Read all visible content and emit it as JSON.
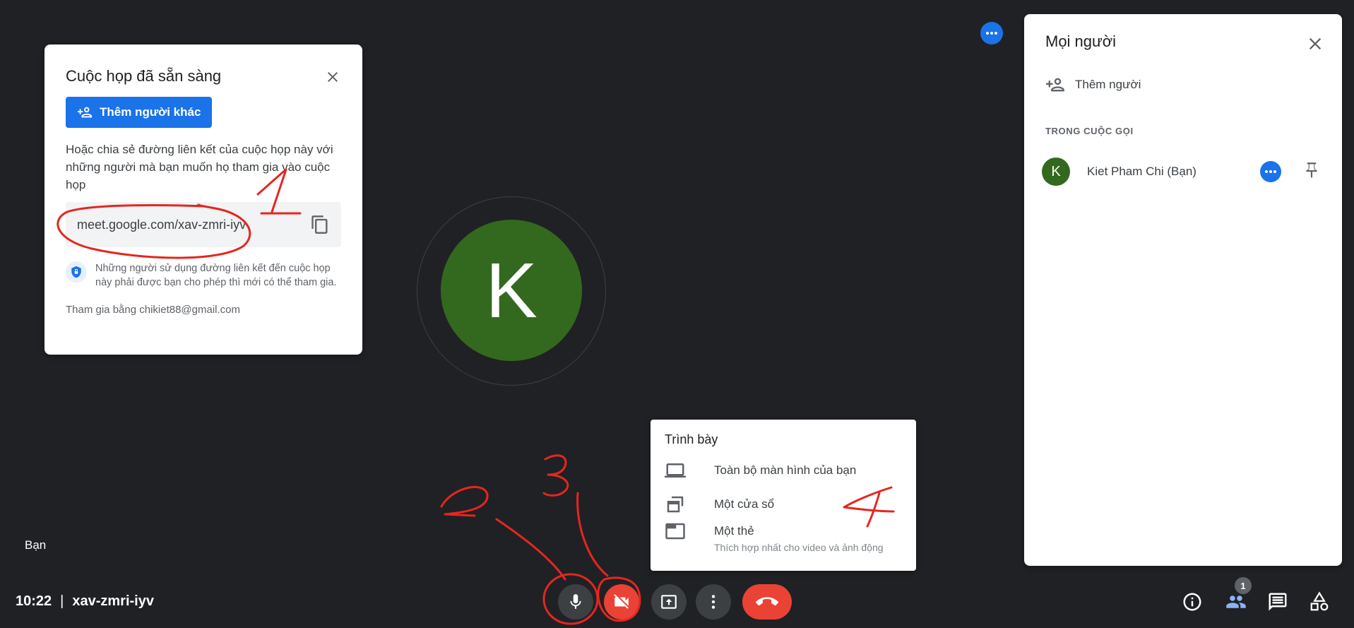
{
  "ready_dialog": {
    "title": "Cuộc họp đã sẵn sàng",
    "add_button": "Thêm người khác",
    "share_text": "Hoặc chia sẻ đường liên kết của cuộc họp này với những người mà bạn muốn họ tham gia vào cuộc họp",
    "link": "meet.google.com/xav-zmri-iyv",
    "info_text": "Những người sử dụng đường liên kết đến cuộc họp này phải được bạn cho phép thì mới có thể tham gia.",
    "joined_as": "Tham gia bằng chikiet88@gmail.com"
  },
  "main": {
    "avatar_letter": "K",
    "you_label": "Bạn"
  },
  "people_panel": {
    "title": "Mọi người",
    "add_person": "Thêm người",
    "section_label": "TRONG CUỘC GỌI",
    "participants": [
      {
        "initial": "K",
        "name": "Kiet Pham Chi (Bạn)"
      }
    ]
  },
  "present_menu": {
    "title": "Trình bày",
    "items": [
      {
        "label": "Toàn bộ màn hình của bạn",
        "icon": "laptop-icon"
      },
      {
        "label": "Một cửa sổ",
        "icon": "window-icon"
      },
      {
        "label": "Một thẻ",
        "sub": "Thích hợp nhất cho video và ảnh động",
        "icon": "tab-icon"
      }
    ]
  },
  "bottom_bar": {
    "time": "10:22",
    "separator": "|",
    "meeting_code": "xav-zmri-iyv",
    "people_count": "1"
  },
  "annotations": [
    "1",
    "2",
    "3",
    "4"
  ],
  "colors": {
    "background": "#202124",
    "accent": "#1a73e8",
    "danger": "#ea4335",
    "avatar": "#33691e",
    "annotation": "#e5261f"
  }
}
